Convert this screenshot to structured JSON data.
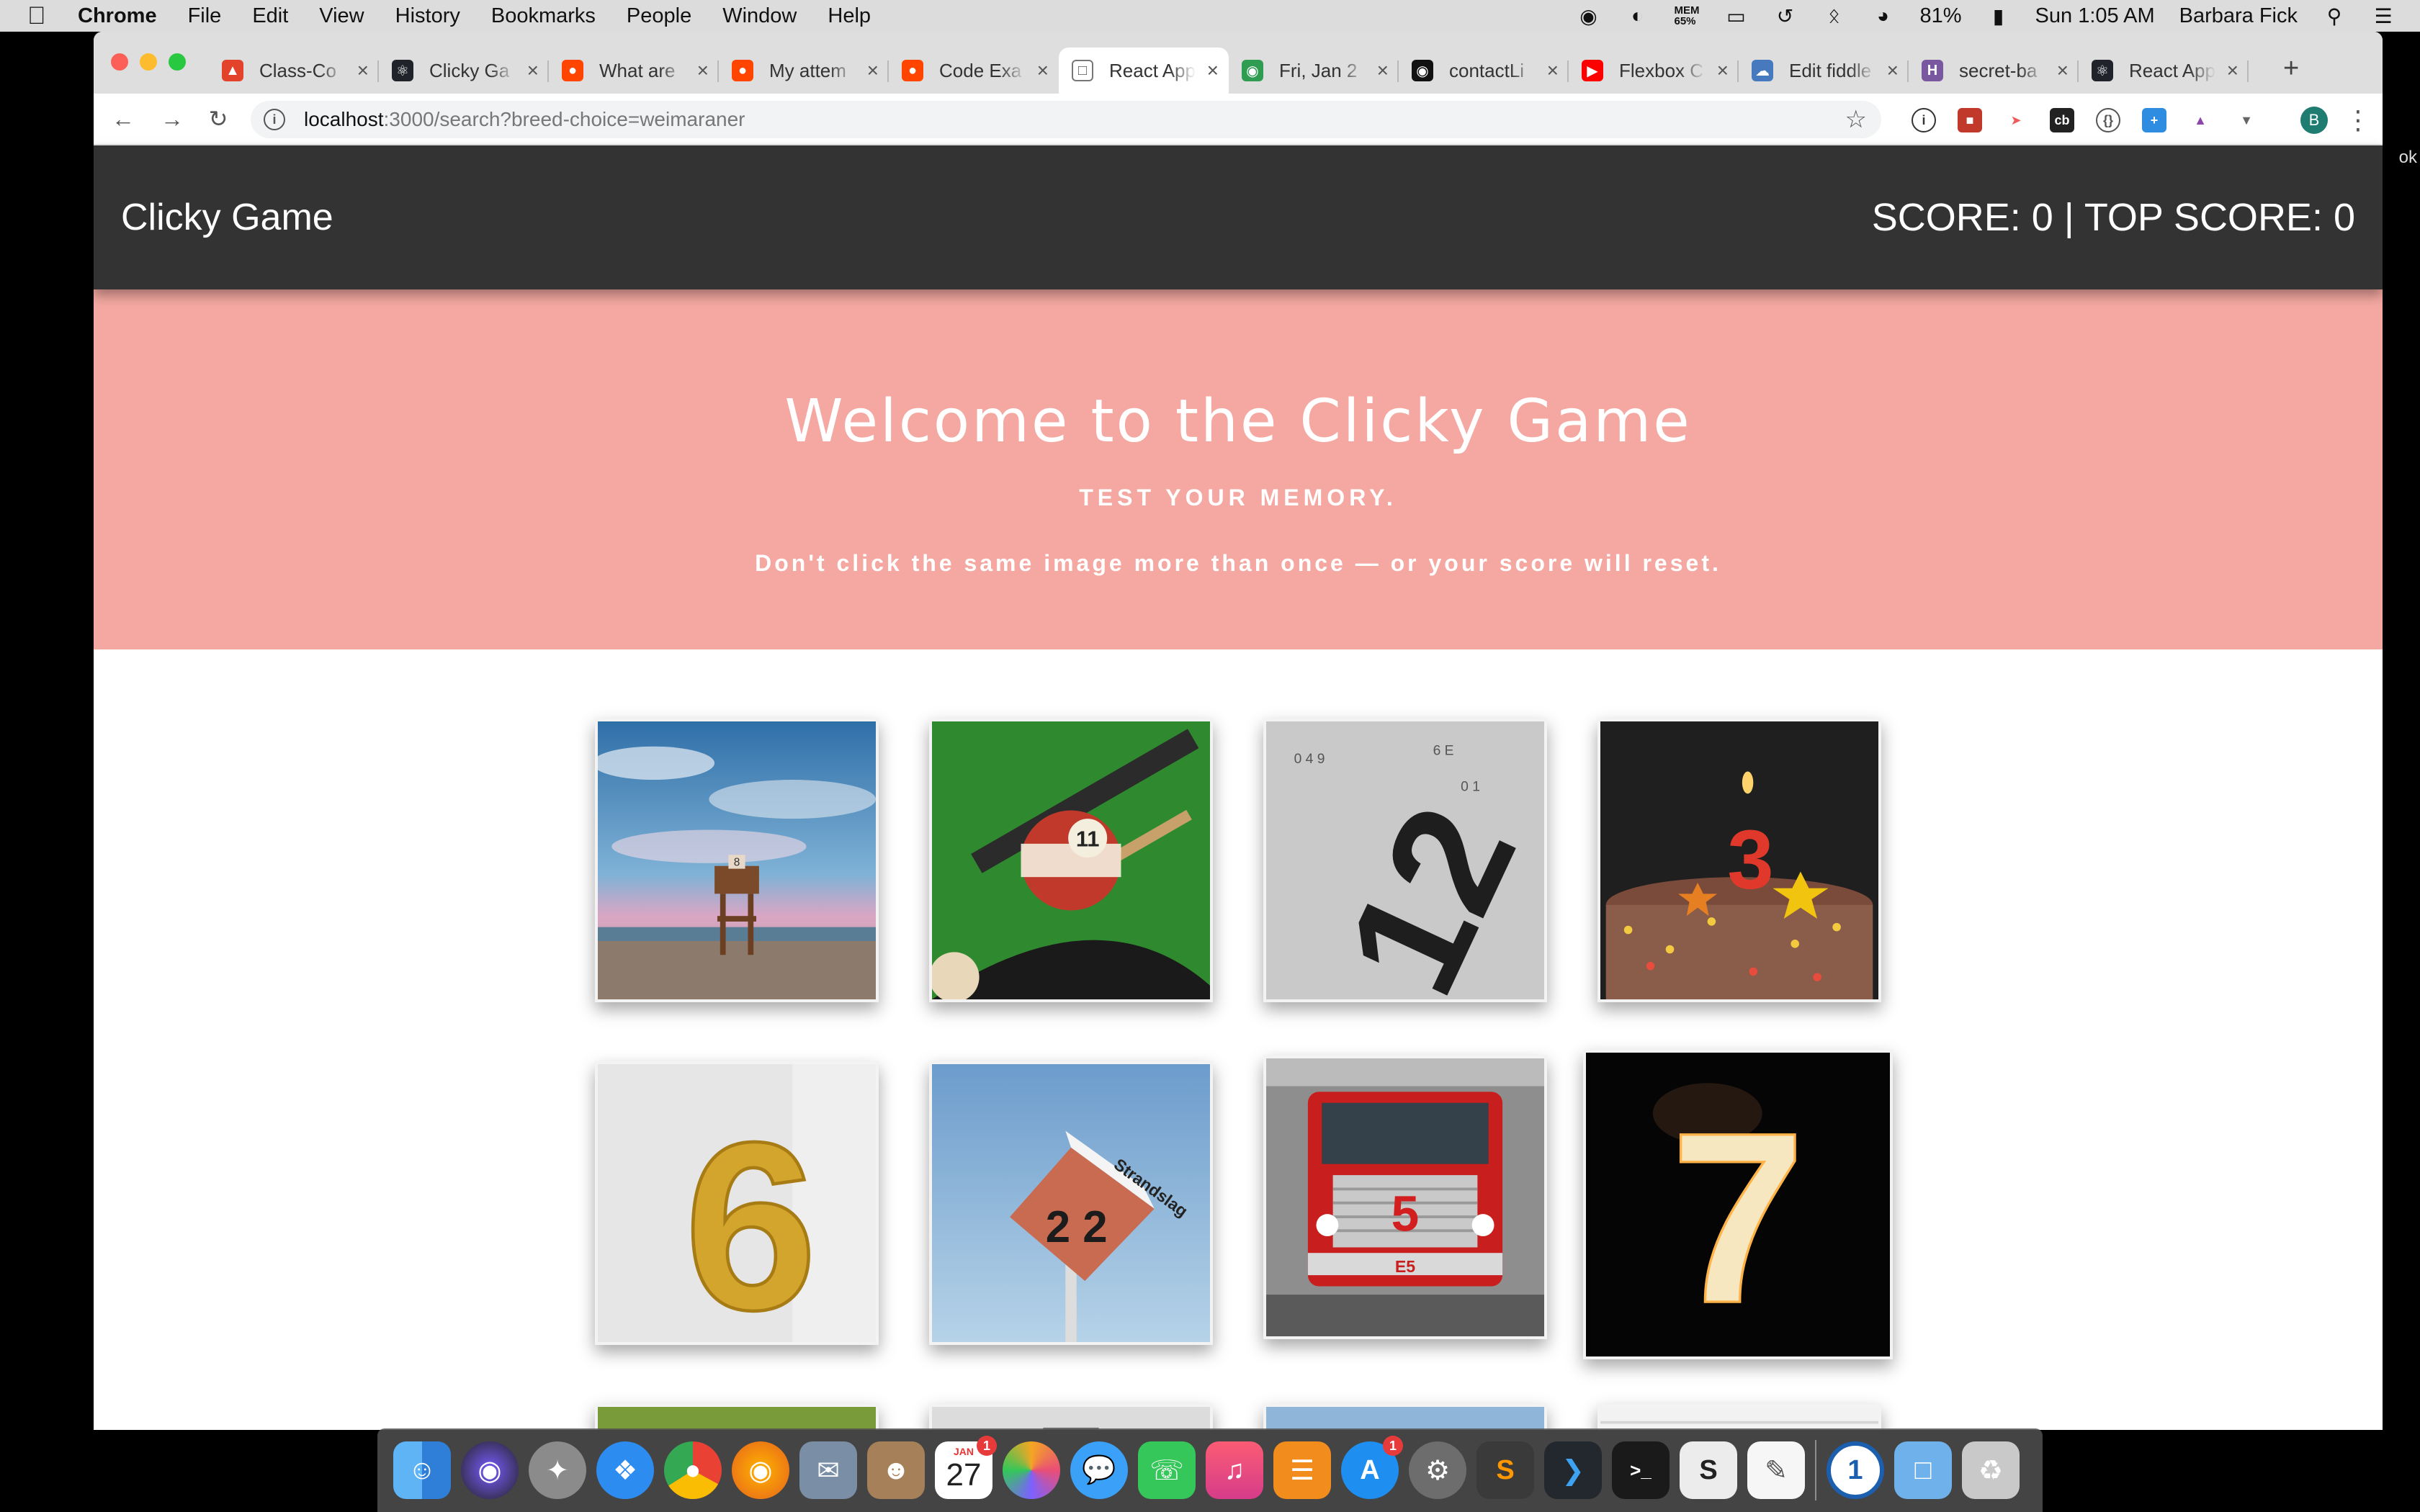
{
  "menubar": {
    "items": [
      "Chrome",
      "File",
      "Edit",
      "View",
      "History",
      "Bookmarks",
      "People",
      "Window",
      "Help"
    ],
    "mem_label": "MEM",
    "mem_value": "65%",
    "battery": "81%",
    "clock": "Sun 1:05 AM",
    "user": "Barbara Fick"
  },
  "tabs": [
    {
      "title": "Class-Co",
      "icon": "gitlab-icon",
      "color": "#e2432a"
    },
    {
      "title": "Clicky Ga",
      "icon": "react-icon",
      "color": "#20232a"
    },
    {
      "title": "What are",
      "icon": "reddit-icon",
      "color": "#ff4500"
    },
    {
      "title": "My attem",
      "icon": "reddit-icon",
      "color": "#ff4500"
    },
    {
      "title": "Code Exa",
      "icon": "reddit-icon",
      "color": "#ff4500"
    },
    {
      "title": "React App",
      "icon": "page-icon",
      "color": "#ffffff"
    },
    {
      "title": "Fri, Jan 2",
      "icon": "calendar-icon",
      "color": "#2e9d52"
    },
    {
      "title": "contactLi",
      "icon": "github-icon",
      "color": "#111111"
    },
    {
      "title": "Flexbox C",
      "icon": "youtube-icon",
      "color": "#ff0000"
    },
    {
      "title": "Edit fiddle",
      "icon": "jsfiddle-icon",
      "color": "#4679bd"
    },
    {
      "title": "secret-ba",
      "icon": "heroku-icon",
      "color": "#79589f"
    },
    {
      "title": "React App",
      "icon": "react-icon",
      "color": "#20232a"
    }
  ],
  "active_tab": 5,
  "url": {
    "host": "localhost",
    "path": ":3000/search?breed-choice=weimaraner"
  },
  "avatar_initial": "B",
  "app": {
    "brand": "Clicky Game",
    "score_text": "SCORE: 0 | TOP SCORE: 0",
    "title": "Welcome to the Clicky Game",
    "subtitle": "TEST YOUR MEMORY.",
    "instructions": "Don't click the same image more than once — or your score will reset."
  },
  "cards": [
    {
      "name": "lifeguard-tower-card",
      "number": "8"
    },
    {
      "name": "billiard-ball-card",
      "number": "11"
    },
    {
      "name": "number-12-card",
      "number": "12"
    },
    {
      "name": "birthday-cake-card",
      "number": "3"
    },
    {
      "name": "gold-balloon-6-card",
      "number": "6"
    },
    {
      "name": "strandslag-sign-card",
      "number": "2 2",
      "sign": "Strandslag"
    },
    {
      "name": "fire-truck-card",
      "number": "5",
      "plate": "E5"
    },
    {
      "name": "sparkler-7-card",
      "number": "7"
    }
  ],
  "dock": {
    "calendar_month": "JAN",
    "calendar_day": "27",
    "badge_count": "1",
    "app_store_badge": "1"
  },
  "colors": {
    "navbar": "#333333",
    "hero": "#f4a8a1",
    "accent": "#ffffff"
  }
}
